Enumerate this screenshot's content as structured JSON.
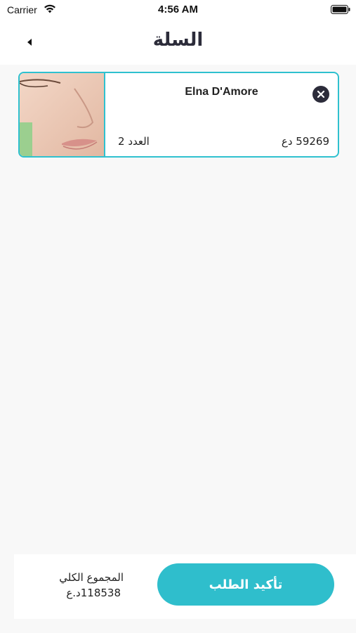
{
  "status_bar": {
    "carrier": "Carrier",
    "time": "4:56 AM"
  },
  "header": {
    "title": "السلة",
    "back_icon": "back-arrow-icon"
  },
  "cart": {
    "items": [
      {
        "name": "Elna D'Amore",
        "quantity_text": "العدد 2",
        "price_text": "59269 دع",
        "image": "face-photo",
        "remove_icon": "close-circle-icon"
      }
    ]
  },
  "footer": {
    "confirm_label": "تأكيد الطلب",
    "total_label": "المجموع الكلي",
    "total_value": "118538د.ع"
  },
  "colors": {
    "accent": "#2fbecc",
    "title": "#2c2c3a",
    "background": "#f8f8f8"
  }
}
